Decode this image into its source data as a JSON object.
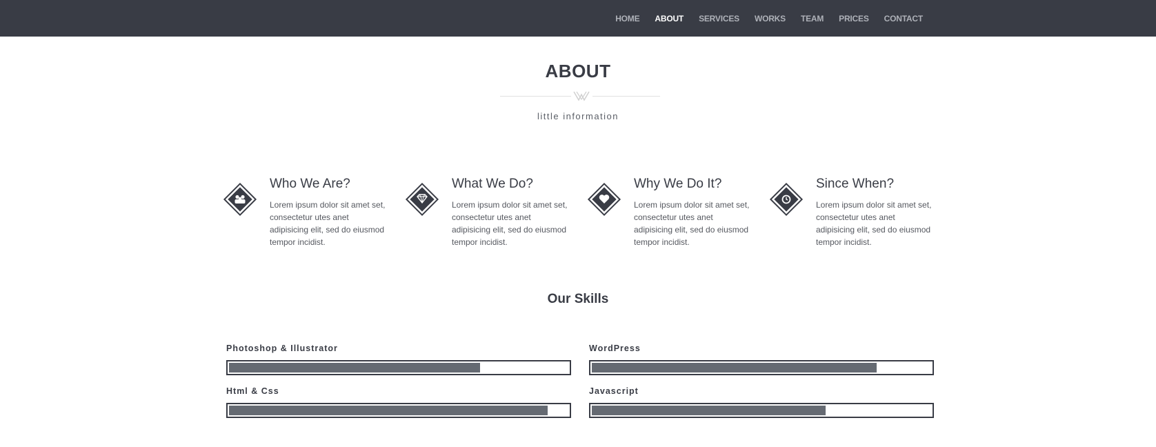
{
  "nav": {
    "items": [
      {
        "label": "HOME",
        "active": false
      },
      {
        "label": "ABOUT",
        "active": true
      },
      {
        "label": "SERVICES",
        "active": false
      },
      {
        "label": "WORKS",
        "active": false
      },
      {
        "label": "TEAM",
        "active": false
      },
      {
        "label": "PRICES",
        "active": false
      },
      {
        "label": "CONTACT",
        "active": false
      }
    ]
  },
  "about": {
    "title": "ABOUT",
    "subtitle": "little information"
  },
  "features": [
    {
      "icon": "users-icon",
      "title": "Who We Are?",
      "text": "Lorem ipsum dolor sit amet set, consectetur utes anet adipisicing elit, sed do eiusmod tempor incidist."
    },
    {
      "icon": "diamond-icon",
      "title": "What We Do?",
      "text": "Lorem ipsum dolor sit amet set, consectetur utes anet adipisicing elit, sed do eiusmod tempor incidist."
    },
    {
      "icon": "heart-icon",
      "title": "Why We Do It?",
      "text": "Lorem ipsum dolor sit amet set, consectetur utes anet adipisicing elit, sed do eiusmod tempor incidist."
    },
    {
      "icon": "clock-icon",
      "title": "Since When?",
      "text": "Lorem ipsum dolor sit amet set, consectetur utes anet adipisicing elit, sed do eiusmod tempor incidist."
    }
  ],
  "skills": {
    "title": "Our Skills",
    "items": [
      {
        "label": "Photoshop & Illustrator",
        "level": 0.74
      },
      {
        "label": "WordPress",
        "level": 0.84
      },
      {
        "label": "Html & Css",
        "level": 0.94
      },
      {
        "label": "Javascript",
        "level": 0.69
      }
    ]
  },
  "colors": {
    "dark": "#393c45",
    "bar_fill": "#656a72",
    "nav_text": "#aeb1b8",
    "nav_active": "#ffffff"
  }
}
